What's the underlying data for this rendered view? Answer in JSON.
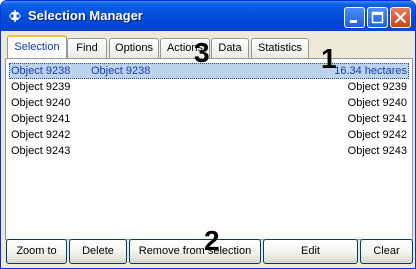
{
  "window": {
    "title": "Selection Manager",
    "icon": "app-icon",
    "controls": [
      "minimize-icon",
      "maximize-icon",
      "close-icon"
    ]
  },
  "tabs": [
    {
      "label": "Selection",
      "active": true
    },
    {
      "label": "Find"
    },
    {
      "label": "Options"
    },
    {
      "label": "Actions"
    },
    {
      "label": "Data"
    },
    {
      "label": "Statistics"
    }
  ],
  "list": {
    "rows": [
      {
        "name": "Object 9238",
        "id": "Object 9238",
        "value": "16.34 hectares",
        "selected": true
      },
      {
        "name": "Object 9239",
        "id": "",
        "value": "Object 9239"
      },
      {
        "name": "Object 9240",
        "id": "",
        "value": "Object 9240"
      },
      {
        "name": "Object 9241",
        "id": "",
        "value": "Object 9241"
      },
      {
        "name": "Object 9242",
        "id": "",
        "value": "Object 9242"
      },
      {
        "name": "Object 9243",
        "id": "",
        "value": "Object 9243"
      }
    ]
  },
  "buttons": {
    "zoom_to": "Zoom to",
    "delete": "Delete",
    "remove_from_selection": "Remove from selection",
    "edit": "Edit",
    "clear": "Clear"
  },
  "annotations": {
    "one": "1",
    "two": "2",
    "three": "3"
  },
  "colors": {
    "titlebar": "#0451dd",
    "selected_row": "#bcd3ec",
    "active_tab_text": "#0b3b9f",
    "close_button": "#c8401c"
  }
}
